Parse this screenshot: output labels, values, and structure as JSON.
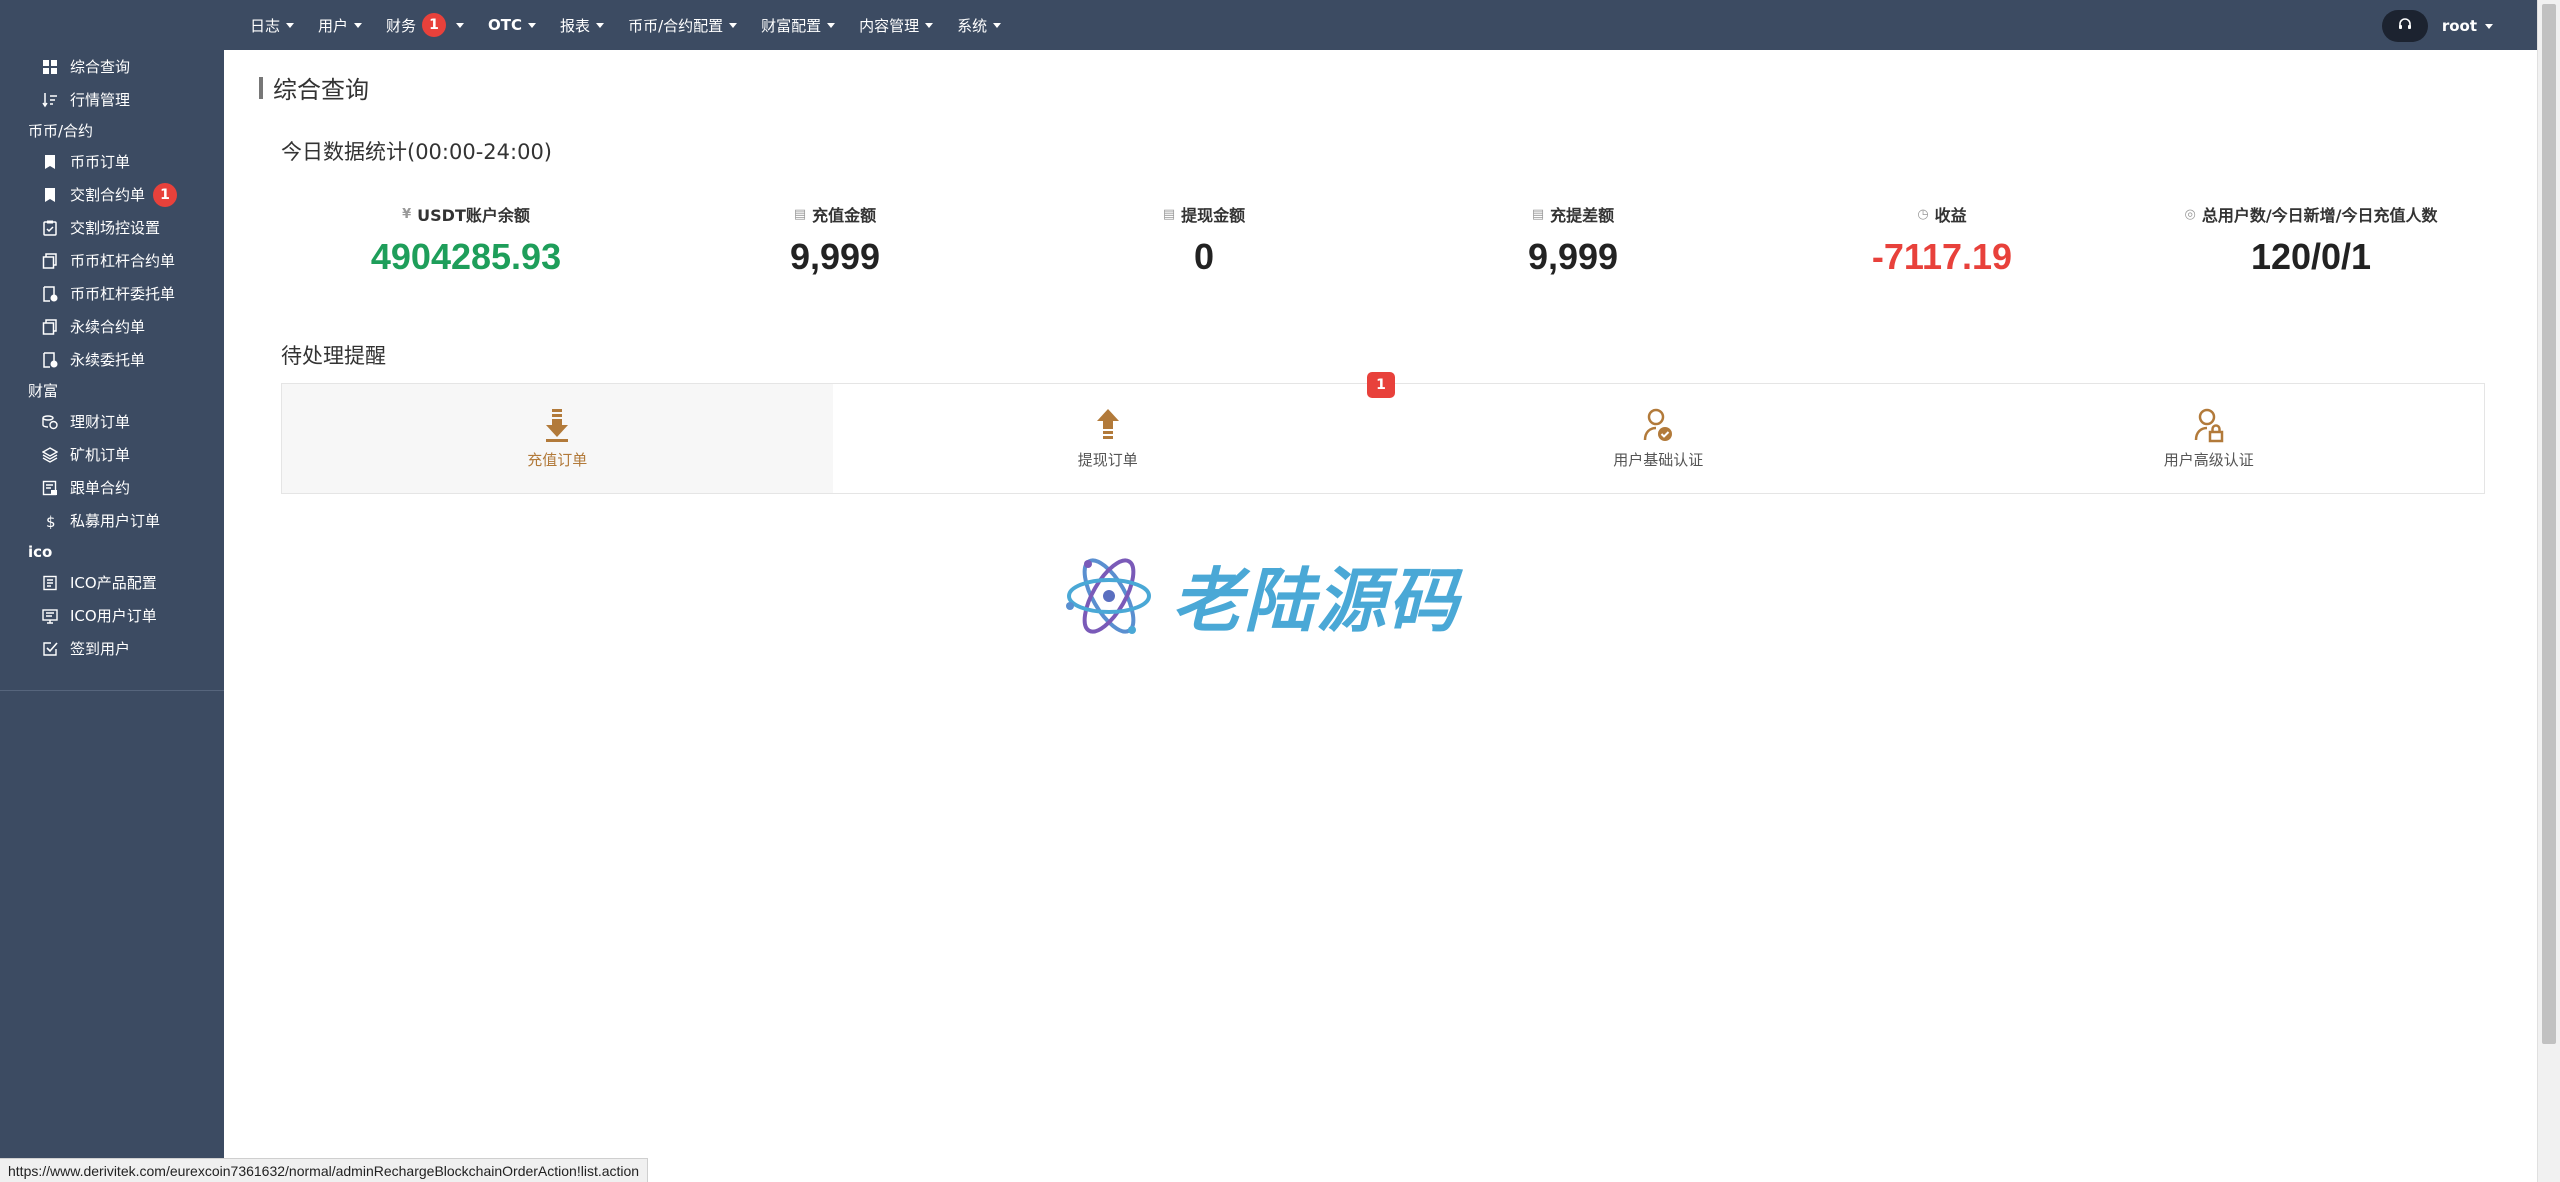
{
  "sidebar": {
    "items": [
      {
        "label": "综合查询",
        "icon": "dashboard-icon"
      },
      {
        "label": "行情管理",
        "icon": "sort-icon"
      }
    ],
    "group_coin": "币币/合约",
    "coin_items": [
      {
        "label": "币币订单",
        "icon": "bookmark-icon"
      },
      {
        "label": "交割合约单",
        "icon": "bookmark-icon",
        "badge": "1"
      },
      {
        "label": "交割场控设置",
        "icon": "clipboard-icon"
      },
      {
        "label": "币币杠杆合约单",
        "icon": "copy-icon"
      },
      {
        "label": "币币杠杆委托单",
        "icon": "clock-doc-icon"
      },
      {
        "label": "永续合约单",
        "icon": "copy-icon"
      },
      {
        "label": "永续委托单",
        "icon": "clock-doc-icon"
      }
    ],
    "group_wealth": "财富",
    "wealth_items": [
      {
        "label": "理财订单",
        "icon": "coins-icon"
      },
      {
        "label": "矿机订单",
        "icon": "layers-icon"
      },
      {
        "label": "跟单合约",
        "icon": "doc-edit-icon"
      },
      {
        "label": "私募用户订单",
        "icon": "dollar-icon"
      }
    ],
    "group_ico": "ico",
    "ico_items": [
      {
        "label": "ICO产品配置",
        "icon": "doc-icon"
      },
      {
        "label": "ICO用户订单",
        "icon": "monitor-icon"
      },
      {
        "label": "签到用户",
        "icon": "checkbox-icon"
      }
    ]
  },
  "topnav": {
    "items": [
      {
        "label": "日志"
      },
      {
        "label": "用户"
      },
      {
        "label": "财务",
        "badge": "1"
      },
      {
        "label": "OTC"
      },
      {
        "label": "报表"
      },
      {
        "label": "币币/合约配置"
      },
      {
        "label": "财富配置"
      },
      {
        "label": "内容管理"
      },
      {
        "label": "系统"
      }
    ],
    "user": "root"
  },
  "page": {
    "title": "综合查询",
    "stats_title": "今日数据统计(00:00-24:00)",
    "pending_title": "待处理提醒"
  },
  "stats": [
    {
      "label": "USDT账户余额",
      "value": "4904285.93",
      "color": "#1e9e5a",
      "icon": "yen-icon"
    },
    {
      "label": "充值金额",
      "value": "9,999",
      "color": "#222222",
      "icon": "doc-icon"
    },
    {
      "label": "提现金额",
      "value": "0",
      "color": "#222222",
      "icon": "doc-icon"
    },
    {
      "label": "充提差额",
      "value": "9,999",
      "color": "#222222",
      "icon": "doc-icon"
    },
    {
      "label": "收益",
      "value": "-7117.19",
      "color": "#e8413b",
      "icon": "clock-icon"
    },
    {
      "label": "总用户数/今日新增/今日充值人数",
      "value": "120/0/1",
      "color": "#222222",
      "icon": "user-circle-icon"
    }
  ],
  "pending": [
    {
      "label": "充值订单",
      "icon": "arrow-down-icon",
      "active": true
    },
    {
      "label": "提现订单",
      "icon": "arrow-up-icon",
      "badge": "1"
    },
    {
      "label": "用户基础认证",
      "icon": "user-check-icon"
    },
    {
      "label": "用户高级认证",
      "icon": "user-lock-icon"
    }
  ],
  "watermark": "老陆源码",
  "statusbar": "https://www.derivitek.com/eurexcoin7361632/normal/adminRechargeBlockchainOrderAction!list.action",
  "colors": {
    "sidebar_bg": "#3c4b62",
    "badge": "#e8413b",
    "accent_brown": "#b27a3a",
    "green": "#1e9e5a",
    "red": "#e8413b"
  }
}
